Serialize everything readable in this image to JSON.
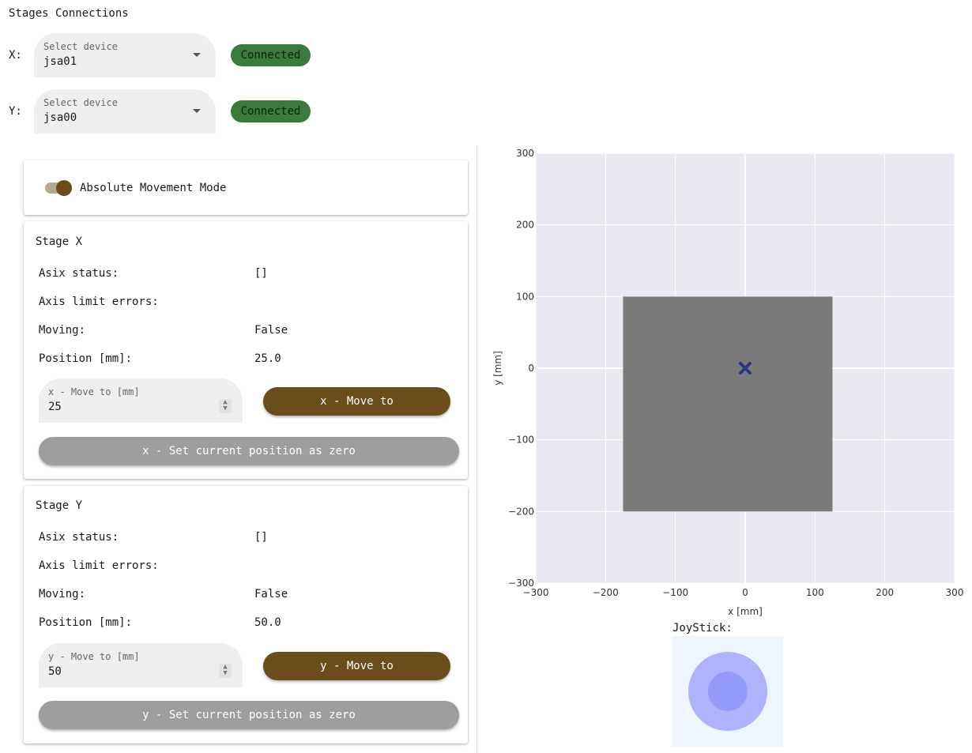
{
  "header": {
    "title": "Stages Connections"
  },
  "connections": {
    "x": {
      "axis_label": "X:",
      "select_label": "Select device",
      "value": "jsa01",
      "status": "Connected"
    },
    "y": {
      "axis_label": "Y:",
      "select_label": "Select device",
      "value": "jsa00",
      "status": "Connected"
    }
  },
  "mode": {
    "label": "Absolute Movement Mode",
    "enabled": true
  },
  "stage_x": {
    "title": "Stage X",
    "rows": [
      {
        "label": "Asix status:",
        "value": "[]"
      },
      {
        "label": "Axis limit errors:",
        "value": ""
      },
      {
        "label": "Moving:",
        "value": "False"
      },
      {
        "label": "Position [mm]:",
        "value": "25.0"
      }
    ],
    "move_input_label": "x - Move to [mm]",
    "move_input_value": "25",
    "move_button": "x - Move to",
    "zero_button": "x - Set current position as zero"
  },
  "stage_y": {
    "title": "Stage Y",
    "rows": [
      {
        "label": "Asix status:",
        "value": "[]"
      },
      {
        "label": "Axis limit errors:",
        "value": ""
      },
      {
        "label": "Moving:",
        "value": "False"
      },
      {
        "label": "Position [mm]:",
        "value": "50.0"
      }
    ],
    "move_input_label": "y - Move to [mm]",
    "move_input_value": "50",
    "move_button": "y - Move to",
    "zero_button": "y - Set current position as zero"
  },
  "joystick": {
    "label": "JoyStick:"
  },
  "chart_data": {
    "type": "scatter",
    "xlabel": "x [mm]",
    "ylabel": "y [mm]",
    "xlim": [
      -300,
      300
    ],
    "ylim": [
      -300,
      300
    ],
    "xticks": [
      -300,
      -200,
      -100,
      0,
      100,
      200,
      300
    ],
    "yticks": [
      -300,
      -200,
      -100,
      0,
      100,
      200,
      300
    ],
    "xtick_labels": [
      "−300",
      "−200",
      "−100",
      "0",
      "100",
      "200",
      "300"
    ],
    "ytick_labels": [
      "−300",
      "−200",
      "−100",
      "0",
      "100",
      "200",
      "300"
    ],
    "grid": true,
    "range_rect": {
      "x0": -175,
      "x1": 125,
      "y0": -200,
      "y1": 100,
      "color": "#707070"
    },
    "marker": {
      "x": 0,
      "y": 0,
      "symbol": "x",
      "color": "#2d3580"
    },
    "colors": {
      "background": "#e9e9f1",
      "grid": "#ffffff"
    }
  }
}
